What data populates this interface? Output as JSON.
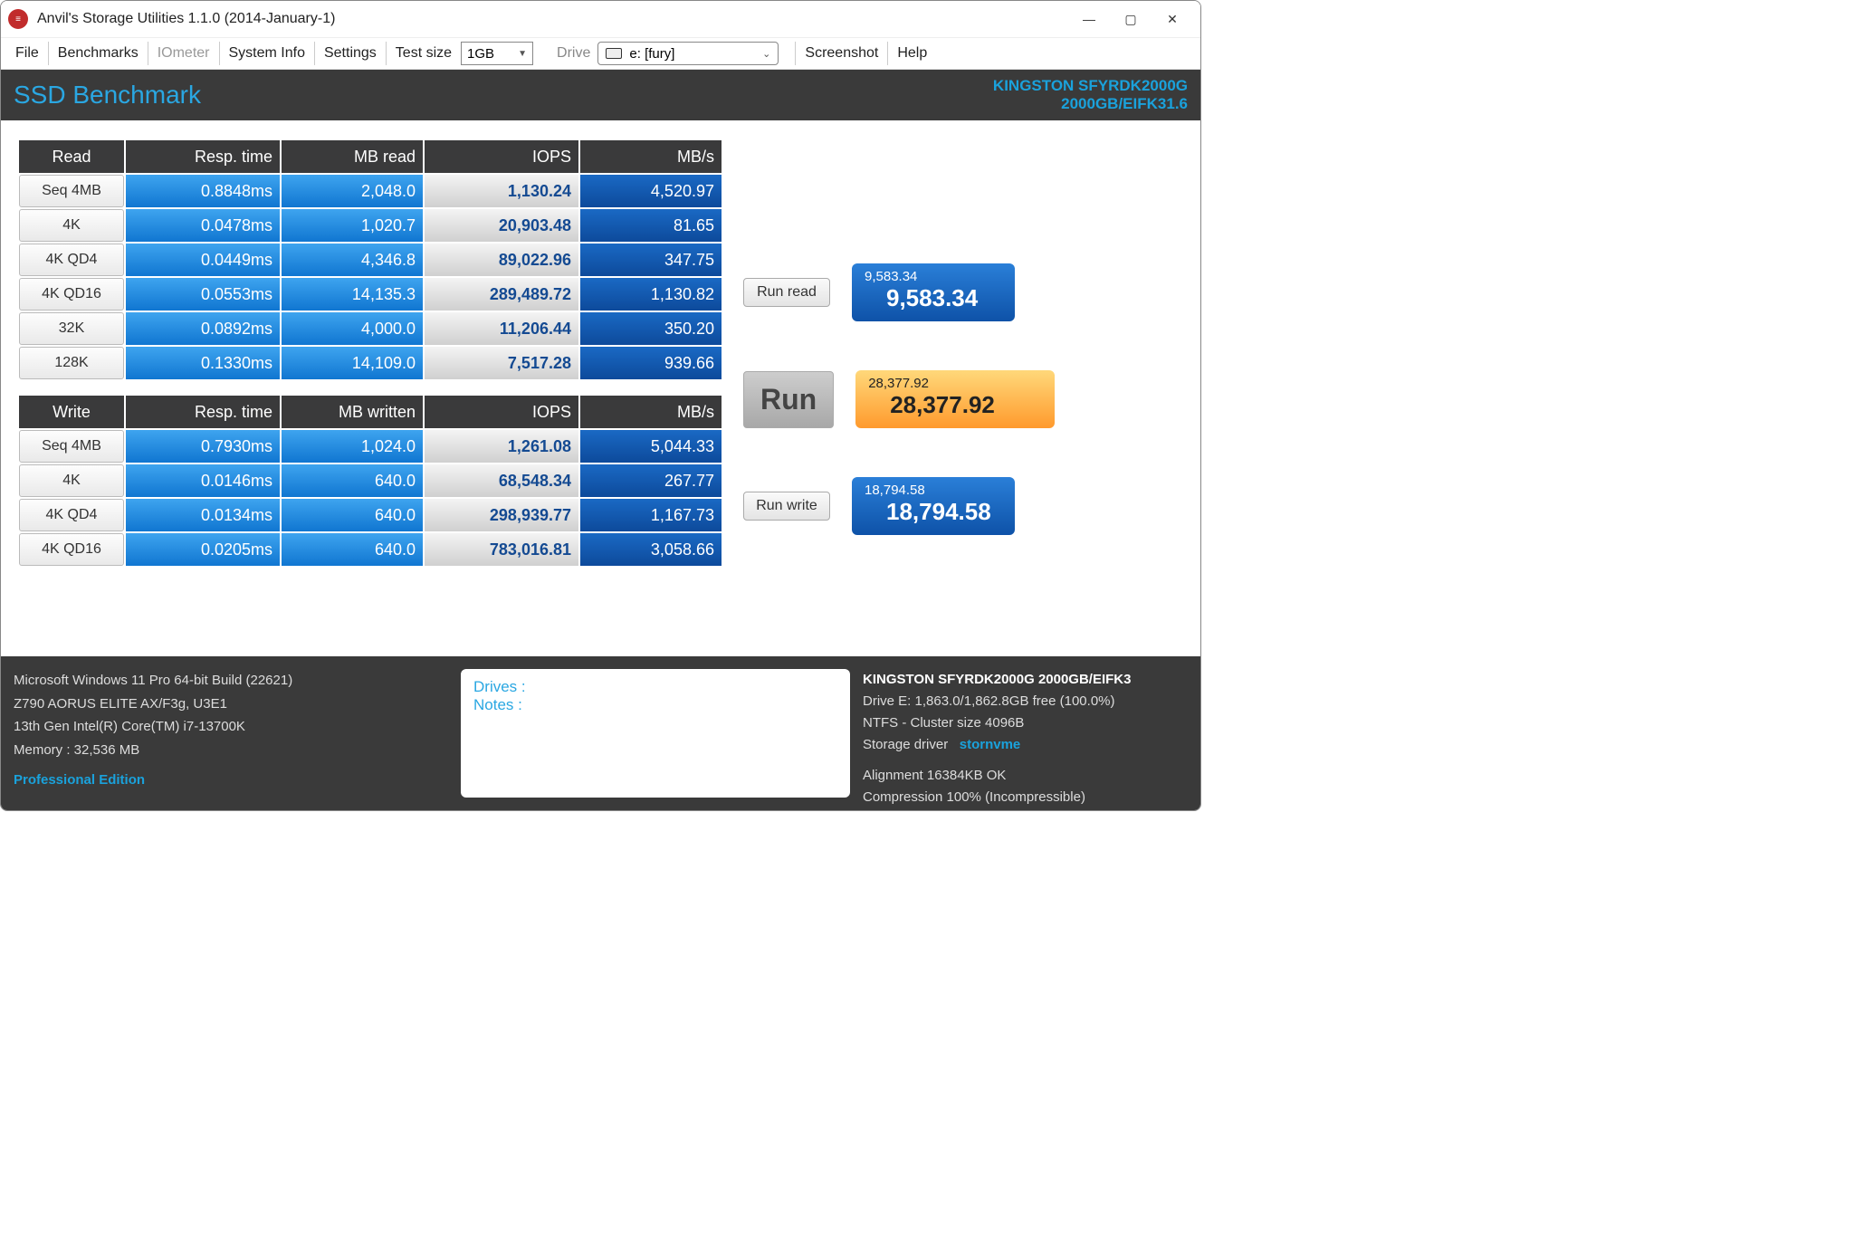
{
  "window": {
    "title": "Anvil's Storage Utilities 1.1.0 (2014-January-1)"
  },
  "menu": {
    "file": "File",
    "benchmarks": "Benchmarks",
    "iometer": "IOmeter",
    "system_info": "System Info",
    "settings": "Settings",
    "test_size_label": "Test size",
    "test_size_value": "1GB",
    "drive_label": "Drive",
    "drive_value": "e: [fury]",
    "screenshot": "Screenshot",
    "help": "Help"
  },
  "header": {
    "title": "SSD Benchmark",
    "device_line1": "KINGSTON SFYRDK2000G",
    "device_line2": "2000GB/EIFK31.6"
  },
  "read_header": {
    "label": "Read",
    "resp": "Resp. time",
    "mb": "MB read",
    "iops": "IOPS",
    "mbs": "MB/s"
  },
  "read_rows": [
    {
      "label": "Seq 4MB",
      "resp": "0.8848ms",
      "mb": "2,048.0",
      "iops": "1,130.24",
      "mbs": "4,520.97"
    },
    {
      "label": "4K",
      "resp": "0.0478ms",
      "mb": "1,020.7",
      "iops": "20,903.48",
      "mbs": "81.65"
    },
    {
      "label": "4K QD4",
      "resp": "0.0449ms",
      "mb": "4,346.8",
      "iops": "89,022.96",
      "mbs": "347.75"
    },
    {
      "label": "4K QD16",
      "resp": "0.0553ms",
      "mb": "14,135.3",
      "iops": "289,489.72",
      "mbs": "1,130.82"
    },
    {
      "label": "32K",
      "resp": "0.0892ms",
      "mb": "4,000.0",
      "iops": "11,206.44",
      "mbs": "350.20"
    },
    {
      "label": "128K",
      "resp": "0.1330ms",
      "mb": "14,109.0",
      "iops": "7,517.28",
      "mbs": "939.66"
    }
  ],
  "write_header": {
    "label": "Write",
    "resp": "Resp. time",
    "mb": "MB written",
    "iops": "IOPS",
    "mbs": "MB/s"
  },
  "write_rows": [
    {
      "label": "Seq 4MB",
      "resp": "0.7930ms",
      "mb": "1,024.0",
      "iops": "1,261.08",
      "mbs": "5,044.33"
    },
    {
      "label": "4K",
      "resp": "0.0146ms",
      "mb": "640.0",
      "iops": "68,548.34",
      "mbs": "267.77"
    },
    {
      "label": "4K QD4",
      "resp": "0.0134ms",
      "mb": "640.0",
      "iops": "298,939.77",
      "mbs": "1,167.73"
    },
    {
      "label": "4K QD16",
      "resp": "0.0205ms",
      "mb": "640.0",
      "iops": "783,016.81",
      "mbs": "3,058.66"
    }
  ],
  "controls": {
    "run_read": "Run read",
    "run": "Run",
    "run_write": "Run write",
    "read_score_small": "9,583.34",
    "read_score_big": "9,583.34",
    "total_score_small": "28,377.92",
    "total_score_big": "28,377.92",
    "write_score_small": "18,794.58",
    "write_score_big": "18,794.58"
  },
  "footer": {
    "os": "Microsoft Windows 11 Pro 64-bit Build (22621)",
    "mb": "Z790 AORUS ELITE AX/F3g, U3E1",
    "cpu": "13th Gen Intel(R) Core(TM) i7-13700K",
    "mem": "Memory : 32,536 MB",
    "edition": "Professional Edition",
    "drives_label": "Drives :",
    "notes_label": "Notes :",
    "drive_heading": "KINGSTON SFYRDK2000G 2000GB/EIFK3",
    "drive_free": "Drive E: 1,863.0/1,862.8GB free (100.0%)",
    "drive_fs": "NTFS - Cluster size 4096B",
    "drive_drv_label": "Storage driver",
    "drive_drv": "stornvme",
    "drive_align": "Alignment 16384KB OK",
    "drive_comp": "Compression 100% (Incompressible)"
  },
  "chart_data": {
    "type": "table",
    "title": "SSD Benchmark",
    "device": "KINGSTON SFYRDK2000G 2000GB/EIFK31.6",
    "read": {
      "columns": [
        "Test",
        "Resp. time (ms)",
        "MB read",
        "IOPS",
        "MB/s"
      ],
      "rows": [
        [
          "Seq 4MB",
          0.8848,
          2048.0,
          1130.24,
          4520.97
        ],
        [
          "4K",
          0.0478,
          1020.7,
          20903.48,
          81.65
        ],
        [
          "4K QD4",
          0.0449,
          4346.8,
          89022.96,
          347.75
        ],
        [
          "4K QD16",
          0.0553,
          14135.3,
          289489.72,
          1130.82
        ],
        [
          "32K",
          0.0892,
          4000.0,
          11206.44,
          350.2
        ],
        [
          "128K",
          0.133,
          14109.0,
          7517.28,
          939.66
        ]
      ],
      "score": 9583.34
    },
    "write": {
      "columns": [
        "Test",
        "Resp. time (ms)",
        "MB written",
        "IOPS",
        "MB/s"
      ],
      "rows": [
        [
          "Seq 4MB",
          0.793,
          1024.0,
          1261.08,
          5044.33
        ],
        [
          "4K",
          0.0146,
          640.0,
          68548.34,
          267.77
        ],
        [
          "4K QD4",
          0.0134,
          640.0,
          298939.77,
          1167.73
        ],
        [
          "4K QD16",
          0.0205,
          640.0,
          783016.81,
          3058.66
        ]
      ],
      "score": 18794.58
    },
    "total_score": 28377.92
  }
}
